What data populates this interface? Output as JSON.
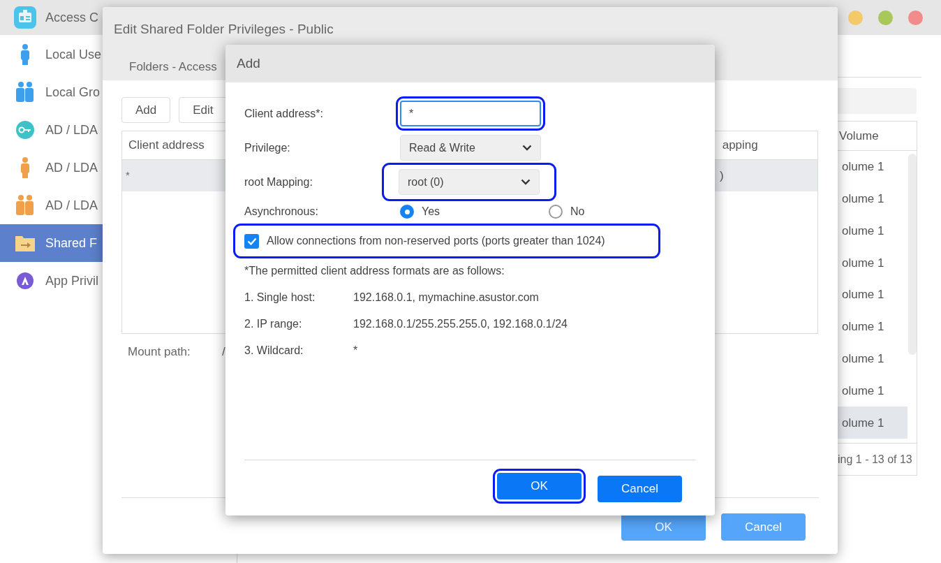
{
  "app": {
    "title": "Access C"
  },
  "sidebar": {
    "items": [
      {
        "label": "Local Use",
        "kind": "local-user",
        "selected": false
      },
      {
        "label": "Local Gro",
        "kind": "local-group",
        "selected": false
      },
      {
        "label": "AD / LDA",
        "kind": "ad-key",
        "selected": false
      },
      {
        "label": "AD / LDA",
        "kind": "ad-user",
        "selected": false
      },
      {
        "label": "AD / LDA",
        "kind": "ad-group",
        "selected": false
      },
      {
        "label": "Shared F",
        "kind": "shared-folder",
        "selected": true
      },
      {
        "label": "App Privil",
        "kind": "app",
        "selected": false
      }
    ]
  },
  "right_panel": {
    "column_header": "Volume",
    "rows": [
      {
        "text": "olume 1",
        "selected": false
      },
      {
        "text": "olume 1",
        "selected": false
      },
      {
        "text": "olume 1",
        "selected": false
      },
      {
        "text": "olume 1",
        "selected": false
      },
      {
        "text": "olume 1",
        "selected": false
      },
      {
        "text": "olume 1",
        "selected": false
      },
      {
        "text": "olume 1",
        "selected": false
      },
      {
        "text": "olume 1",
        "selected": false
      },
      {
        "text": "olume 1",
        "selected": true
      }
    ],
    "footer": "ing 1 - 13 of 13"
  },
  "edit_window": {
    "title": "Edit Shared Folder Privileges - Public",
    "tab": "Folders - Access",
    "toolbar": [
      "Add",
      "Edit"
    ],
    "table": {
      "columns": [
        "Client address",
        "apping"
      ],
      "rows": [
        {
          "cells": [
            "*",
            ")"
          ],
          "selected": true
        }
      ]
    },
    "mount_path_label": "Mount path:",
    "mount_path_value": "/",
    "buttons": [
      "OK",
      "Cancel"
    ]
  },
  "add_dialog": {
    "title": "Add",
    "fields": [
      {
        "kind": "input",
        "label": "Client address*:",
        "value": "*",
        "highlighted": true
      },
      {
        "kind": "select",
        "label": "Privilege:",
        "value": "Read & Write",
        "highlighted": false
      },
      {
        "kind": "select",
        "label": "root Mapping:",
        "value": "root (0)",
        "highlighted": true
      },
      {
        "kind": "radio",
        "label": "Asynchronous:",
        "options": [
          {
            "label": "Yes",
            "selected": true
          },
          {
            "label": "No",
            "selected": false
          }
        ]
      }
    ],
    "checkbox": {
      "label": "Allow connections from non-reserved ports (ports greater than 1024)",
      "checked": true,
      "highlighted": true
    },
    "note": "*The permitted client address formats are as follows:",
    "formats": [
      {
        "label": "1. Single host:",
        "value": "192.168.0.1, mymachine.asustor.com"
      },
      {
        "label": "2. IP range:",
        "value": "192.168.0.1/255.255.255.0, 192.168.0.1/24"
      },
      {
        "label": "3. Wildcard:",
        "value": "*"
      }
    ],
    "buttons": [
      {
        "label": "OK",
        "highlighted": true
      },
      {
        "label": "Cancel",
        "highlighted": false
      }
    ]
  }
}
